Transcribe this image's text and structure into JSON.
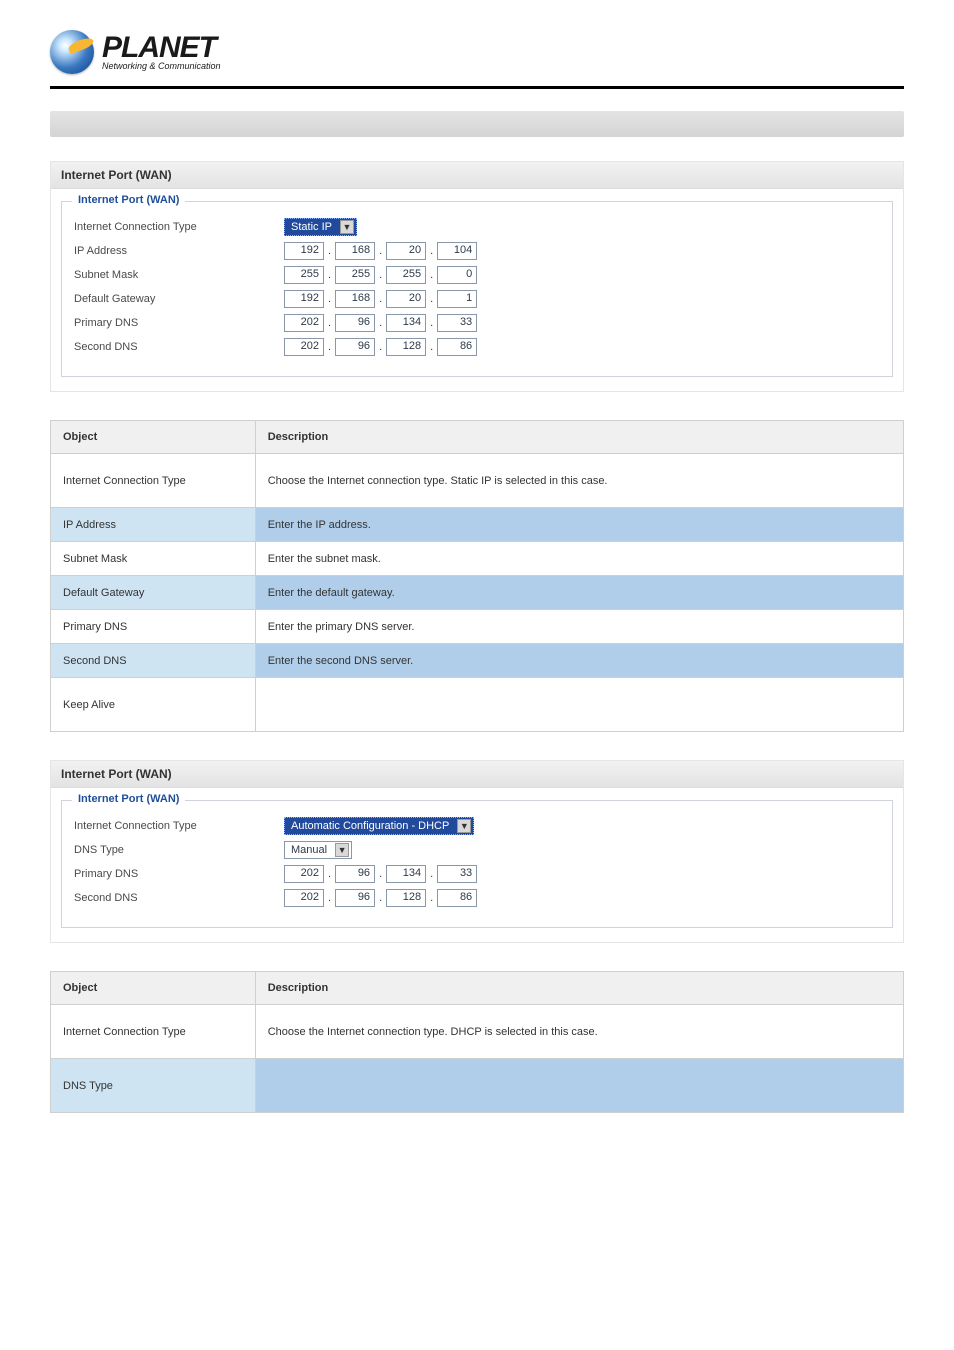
{
  "logo": {
    "brand": "PLANET",
    "tagline": "Networking & Communication"
  },
  "top_gray_band": "",
  "panel_static": {
    "title": "Internet Port (WAN)",
    "legend": "Internet Port (WAN)",
    "rows": {
      "conn_type_label": "Internet Connection Type",
      "conn_type_value": "Static IP",
      "ip_label": "IP Address",
      "mask_label": "Subnet Mask",
      "gw_label": "Default Gateway",
      "pdns_label": "Primary DNS",
      "sdns_label": "Second DNS"
    },
    "ip": {
      "a": "192",
      "b": "168",
      "c": "20",
      "d": "104"
    },
    "mask": {
      "a": "255",
      "b": "255",
      "c": "255",
      "d": "0"
    },
    "gw": {
      "a": "192",
      "b": "168",
      "c": "20",
      "d": "1"
    },
    "pdns": {
      "a": "202",
      "b": "96",
      "c": "134",
      "d": "33"
    },
    "sdns": {
      "a": "202",
      "b": "96",
      "c": "128",
      "d": "86"
    }
  },
  "table_static": {
    "head_obj": "Object",
    "head_desc": "Description",
    "rows": [
      {
        "obj": "Internet Connection Type",
        "desc": "Choose the Internet connection type. Static IP is selected in this case.",
        "alt": false,
        "cls": "tall"
      },
      {
        "obj": "IP Address",
        "desc": "Enter the IP address.",
        "alt": true,
        "cls": "med"
      },
      {
        "obj": "Subnet Mask",
        "desc": "Enter the subnet mask.",
        "alt": false,
        "cls": "med"
      },
      {
        "obj": "Default Gateway",
        "desc": "Enter the default gateway.",
        "alt": true,
        "cls": "med"
      },
      {
        "obj": "Primary DNS",
        "desc": "Enter the primary DNS server.",
        "alt": false,
        "cls": "med"
      },
      {
        "obj": "Second DNS",
        "desc": "Enter the second DNS server.",
        "alt": true,
        "cls": "med"
      },
      {
        "obj": "Keep Alive",
        "desc": "",
        "alt": false,
        "cls": "tall"
      }
    ]
  },
  "panel_dhcp": {
    "title": "Internet Port (WAN)",
    "legend": "Internet Port (WAN)",
    "rows": {
      "conn_type_label": "Internet Connection Type",
      "conn_type_value": "Automatic Configuration - DHCP",
      "dns_type_label": "DNS Type",
      "dns_type_value": "Manual",
      "pdns_label": "Primary DNS",
      "sdns_label": "Second DNS"
    },
    "pdns": {
      "a": "202",
      "b": "96",
      "c": "134",
      "d": "33"
    },
    "sdns": {
      "a": "202",
      "b": "96",
      "c": "128",
      "d": "86"
    }
  },
  "table_dhcp": {
    "head_obj": "Object",
    "head_desc": "Description",
    "rows": [
      {
        "obj": "Internet Connection Type",
        "desc": "Choose the Internet connection type. DHCP is selected in this case.",
        "alt": false,
        "cls": "tall"
      },
      {
        "obj": "DNS Type",
        "desc": "",
        "alt": true,
        "cls": "tall"
      }
    ]
  }
}
